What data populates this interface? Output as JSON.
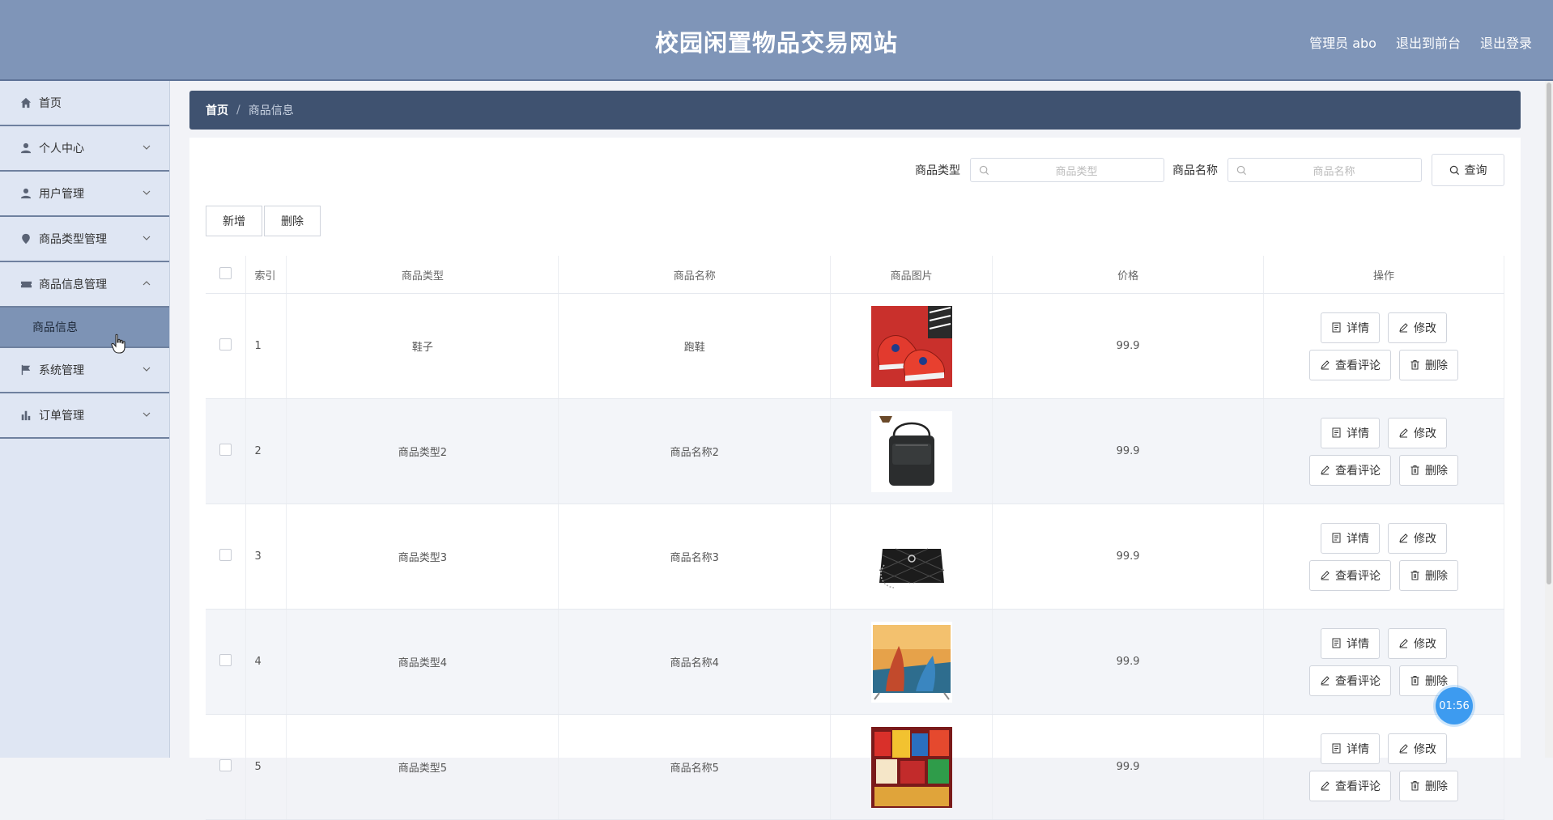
{
  "header": {
    "title": "校园闲置物品交易网站",
    "admin_label": "管理员 abo",
    "to_front": "退出到前台",
    "logout": "退出登录"
  },
  "sidebar": {
    "items": [
      {
        "label": "首页",
        "icon": "home-icon"
      },
      {
        "label": "个人中心",
        "icon": "user-icon"
      },
      {
        "label": "用户管理",
        "icon": "user-icon"
      },
      {
        "label": "商品类型管理",
        "icon": "location-icon"
      },
      {
        "label": "商品信息管理",
        "icon": "ticket-icon"
      },
      {
        "label": "系统管理",
        "icon": "flag-icon"
      },
      {
        "label": "订单管理",
        "icon": "chart-icon"
      }
    ],
    "sub_active": "商品信息"
  },
  "breadcrumb": {
    "home": "首页",
    "sep": "/",
    "current": "商品信息"
  },
  "search": {
    "type_label": "商品类型",
    "type_placeholder": "商品类型",
    "name_label": "商品名称",
    "name_placeholder": "商品名称",
    "query_button": "查询"
  },
  "actions": {
    "add": "新增",
    "delete": "删除"
  },
  "table": {
    "headers": [
      "索引",
      "商品类型",
      "商品名称",
      "商品图片",
      "价格",
      "操作"
    ],
    "rows": [
      {
        "index": "1",
        "type": "鞋子",
        "name": "跑鞋",
        "price": "99.9",
        "image": "red-sneakers"
      },
      {
        "index": "2",
        "type": "商品类型2",
        "name": "商品名称2",
        "price": "99.9",
        "image": "black-shoulder-bag"
      },
      {
        "index": "3",
        "type": "商品类型3",
        "name": "商品名称3",
        "price": "99.9",
        "image": "quilted-handbag"
      },
      {
        "index": "4",
        "type": "商品类型4",
        "name": "商品名称4",
        "price": "99.9",
        "image": "tv-boats"
      },
      {
        "index": "5",
        "type": "商品类型5",
        "name": "商品名称5",
        "price": "99.9",
        "image": "snacks"
      }
    ],
    "ops": {
      "detail": "详情",
      "edit": "修改",
      "comments": "查看评论",
      "delete": "删除"
    }
  },
  "timer": "01:56",
  "colors": {
    "header_bg": "#7f95b8",
    "breadcrumb_bg": "#3f5270",
    "sidebar_bg": "#dfe6f3",
    "active_sub_bg": "#7d93b5",
    "timer_bg": "#3d9bf0"
  }
}
